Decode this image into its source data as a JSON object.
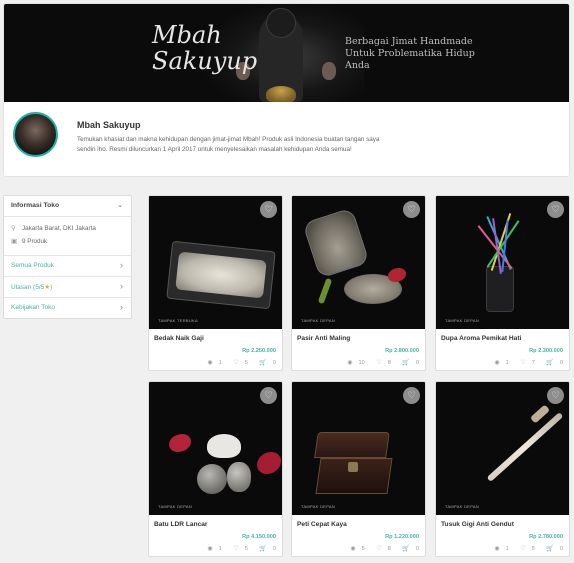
{
  "shop": {
    "banner": {
      "title_line1": "Mbah",
      "title_line2": "Sakuyup",
      "tagline": "Berbagai Jimat Handmade Untuk Problematika Hidup Anda"
    },
    "name": "Mbah Sakuyup",
    "description": "Temukan khasiat dan makna kehidupan dengan jimat-jimat Mbah! Produk asli Indonesia buatan tangan saya sendiri iho. Resmi diluncurkan 1 April 2017 untuk menyelesaikan masalah kehidupan Anda semua!"
  },
  "sidebar": {
    "header": "Informasi Toko",
    "location": "Jakarta Barat, DKI Jakarta",
    "product_count": "9 Produk",
    "links": [
      {
        "label": "Semua Produk"
      },
      {
        "label": "Ulasan (5/5",
        "icon": "star-icon",
        "suffix": ")"
      },
      {
        "label": "Kebijakan Toko"
      }
    ]
  },
  "products": [
    {
      "name": "Bedak Naik Gaji",
      "price": "Rp 2.250.000",
      "watermark": "TAMPAK TERBUKA",
      "views": "1",
      "likes": "5",
      "cart": "0"
    },
    {
      "name": "Pasir Anti Maling",
      "price": "Rp 2.800.000",
      "watermark": "TAMPAK DEPAN",
      "views": "10",
      "likes": "8",
      "cart": "0"
    },
    {
      "name": "Dupa Aroma Pemikat Hati",
      "price": "Rp 2.300.000",
      "watermark": "TAMPAK DEPAN",
      "views": "1",
      "likes": "7",
      "cart": "0"
    },
    {
      "name": "Batu LDR Lancar",
      "price": "Rp 4.150.000",
      "watermark": "TAMPAK DEPAN",
      "views": "1",
      "likes": "5",
      "cart": "0"
    },
    {
      "name": "Peti Cepat Kaya",
      "price": "Rp 1.220.000",
      "watermark": "TAMPAK DEPAN",
      "views": "5",
      "likes": "8",
      "cart": "0"
    },
    {
      "name": "Tusuk Gigi Anti Gendut",
      "price": "Rp 2.780.000",
      "watermark": "TAMPAK DEPAN",
      "views": "1",
      "likes": "5",
      "cart": "0"
    }
  ],
  "colors": {
    "accent": "#42b5a4",
    "avatar_ring": "#1fb3a6",
    "star": "#f5a623"
  }
}
